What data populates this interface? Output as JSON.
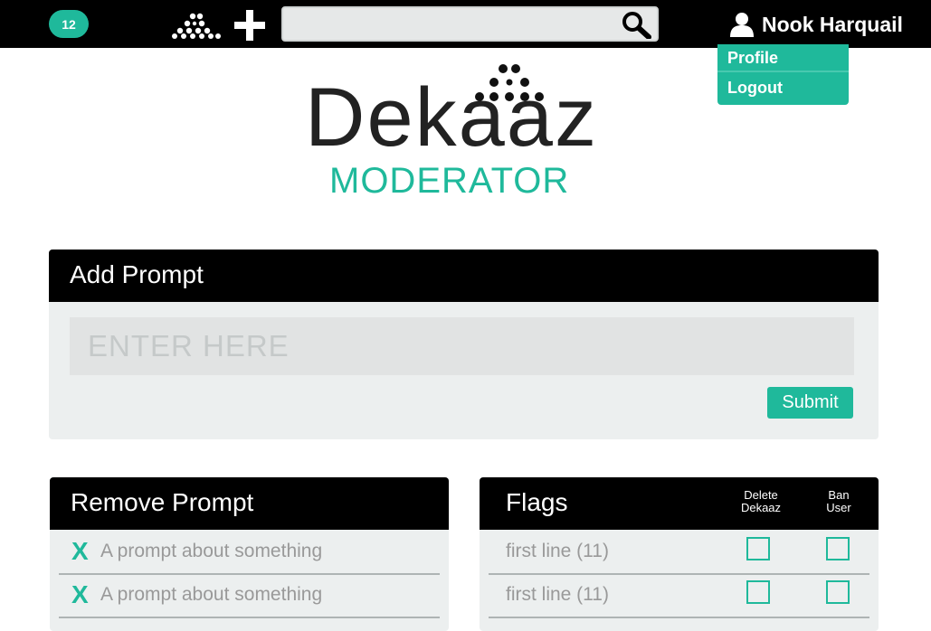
{
  "topbar": {
    "notification_count": "12",
    "search": {
      "value": "",
      "placeholder": ""
    },
    "user_name": "Nook Harquail"
  },
  "user_menu": {
    "items": [
      "Profile",
      "Logout"
    ]
  },
  "logo": {
    "word": "Dekaaz",
    "subtitle": "MODERATOR"
  },
  "add_prompt": {
    "title": "Add Prompt",
    "input_placeholder": "ENTER HERE",
    "input_value": "",
    "submit_label": "Submit"
  },
  "remove_prompt": {
    "title": "Remove Prompt",
    "remove_glyph": "X",
    "items": [
      "A prompt about something",
      "A prompt about something"
    ]
  },
  "flags": {
    "title": "Flags",
    "col_delete_line1": "Delete",
    "col_delete_line2": "Dekaaz",
    "col_ban_line1": "Ban",
    "col_ban_line2": "User",
    "items": [
      "first line (11)",
      "first line (11)"
    ]
  },
  "colors": {
    "accent": "#1fb99b",
    "bar": "#000000",
    "panel": "#ecefef"
  }
}
